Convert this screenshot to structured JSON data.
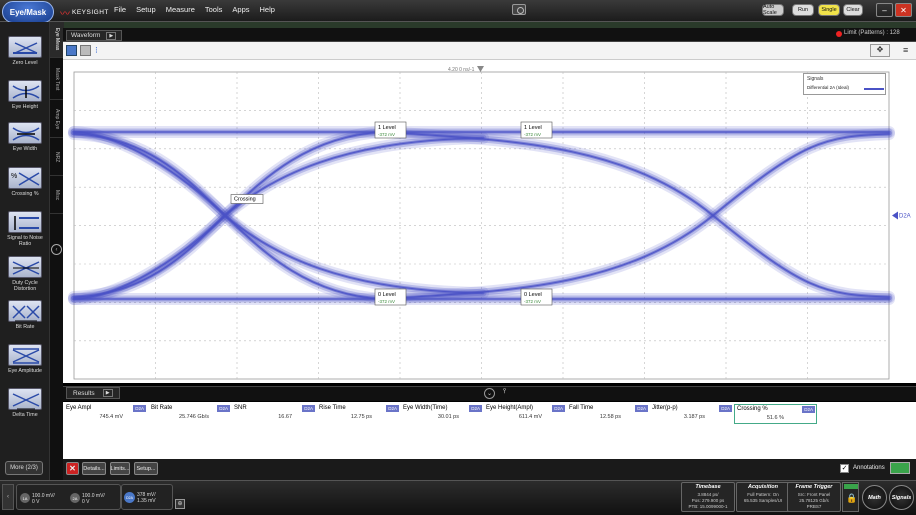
{
  "app": {
    "mode": "Eye/Mask",
    "brand": "KEYSIGHT"
  },
  "menu": [
    "File",
    "Setup",
    "Measure",
    "Tools",
    "Apps",
    "Help"
  ],
  "run_controls": {
    "auto_scale": "Auto Scale",
    "run": "Run",
    "single": "Single",
    "clear": "Clear"
  },
  "status": {
    "limit": "Limit (Patterns) : 128"
  },
  "sidebar": {
    "tools": [
      {
        "label": "Zero Level",
        "icon": "zero-level-icon"
      },
      {
        "label": "Eye Height",
        "icon": "eye-height-icon"
      },
      {
        "label": "Eye Width",
        "icon": "eye-width-icon"
      },
      {
        "label": "Crossing %",
        "icon": "crossing-icon"
      },
      {
        "label": "Signal to Noise Ratio",
        "icon": "snr-icon"
      },
      {
        "label": "Duty Cycle Distortion",
        "icon": "duty-cycle-icon"
      },
      {
        "label": "Bit Rate",
        "icon": "bit-rate-icon"
      },
      {
        "label": "Eye Amplitude",
        "icon": "eye-amplitude-icon"
      },
      {
        "label": "Delta Time",
        "icon": "delta-time-icon"
      }
    ],
    "more": "More (2/3)",
    "tabs": [
      "Eye Meas",
      "Mask Test",
      "Amp Eye",
      "NRZ",
      "Misc"
    ]
  },
  "waveform": {
    "tab": "Waveform",
    "top_marker": "4.20 0 ns/-1",
    "legend_title": "Signals",
    "legend_item": "Differential 2A (Ideal)",
    "channel_marker": "D2A",
    "annotations": [
      {
        "name": "1 Level",
        "value": "-372 mV"
      },
      {
        "name": "1 Level",
        "value": "-372 mV"
      },
      {
        "name": "0 Level",
        "value": "-372 mV"
      },
      {
        "name": "0 Level",
        "value": "-372 mV"
      },
      {
        "name": "Crossing",
        "value": ""
      }
    ]
  },
  "results": {
    "tab": "Results",
    "measurements": [
      {
        "name": "Eye Ampl",
        "value": "745.4 mV",
        "badge": "D2A"
      },
      {
        "name": "Bit Rate",
        "value": "25.746 Gb/s",
        "badge": "D2A"
      },
      {
        "name": "SNR",
        "value": "16.67",
        "badge": "D2A"
      },
      {
        "name": "Rise Time",
        "value": "12.75 ps",
        "badge": "D2A"
      },
      {
        "name": "Eye Width(Time)",
        "value": "30.01 ps",
        "badge": "D2A"
      },
      {
        "name": "Eye Height(Ampl)",
        "value": "611.4 mV",
        "badge": "D2A"
      },
      {
        "name": "Fall Time",
        "value": "12.58 ps",
        "badge": "D2A"
      },
      {
        "name": "Jitter(p-p)",
        "value": "3.187 ps",
        "badge": "D2A"
      },
      {
        "name": "Crossing %",
        "value": "51.6 %",
        "badge": "D2A"
      }
    ],
    "buttons": {
      "details": "Details...",
      "limits": "Limits...",
      "setup": "Setup..."
    },
    "annotations": "Annotations"
  },
  "bottom": {
    "channels": [
      {
        "id": "1A",
        "line1": "100.0 mV/",
        "line2": "0 V"
      },
      {
        "id": "2A",
        "line1": "100.0 mV/",
        "line2": "0 V"
      },
      {
        "id": "D2A",
        "line1": "378 mV/",
        "line2": "1.35 mV"
      }
    ],
    "timebase": {
      "title": "Timebase",
      "l1": "3.8844 ps/",
      "l2": "Pos: 279.900 ps",
      "l3": "PTB: 15.0099000-1"
    },
    "acquisition": {
      "title": "Acquisition",
      "l1": "Full Pattern: On",
      "l2": "65.535 Samples/UI",
      "l3": ""
    },
    "trigger": {
      "title": "Frame Trigger",
      "l1": "Src: Front Panel",
      "l2": "25.78125 Gb/s",
      "l3": "PRBS7"
    },
    "math": "Math",
    "signals": "Signals"
  },
  "colors": {
    "accent": "#3a4fc0",
    "trace": "#4a52c6"
  }
}
